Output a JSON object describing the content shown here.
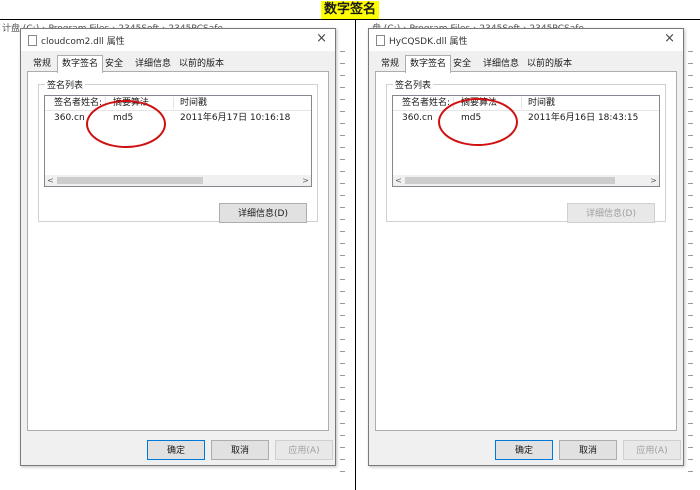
{
  "heading": "数字签名",
  "background": {
    "path_left": "计盘 (C:) › Program Files › 2345Soft › 2345PCSafe",
    "path_right": "盘 (C:) › Program Files › 2345Soft › 2345PCSafe"
  },
  "accent_color": "#0078d7",
  "highlight_color": "#d01010",
  "tabs": [
    "常规",
    "数字签名",
    "安全",
    "详细信息",
    "以前的版本"
  ],
  "active_tab": "数字签名",
  "columns": [
    "签名者姓名:",
    "摘要算法",
    "时间戳"
  ],
  "group_label": "签名列表",
  "details_button": "详细信息(D)",
  "buttons": {
    "ok": "确定",
    "cancel": "取消",
    "apply": "应用(A)"
  },
  "dialogs": [
    {
      "title": "cloudcom2.dll 属性",
      "signer": "360.cn",
      "digest": "md5",
      "timestamp": "2011年6月17日 10:16:18",
      "details_enabled": true
    },
    {
      "title": "HyCQSDK.dll 属性",
      "signer": "360.cn",
      "digest": "md5",
      "timestamp": "2011年6月16日 18:43:15",
      "details_enabled": false
    }
  ]
}
